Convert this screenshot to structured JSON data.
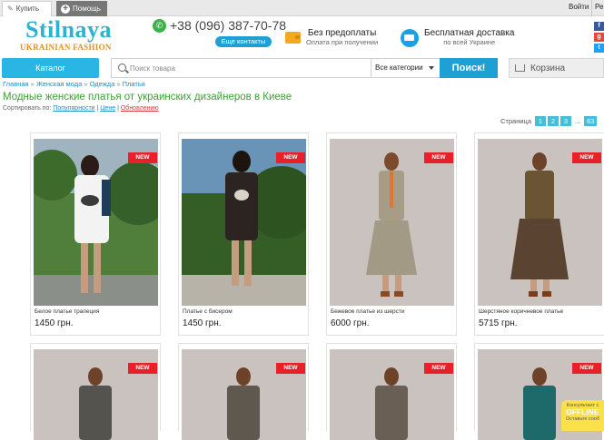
{
  "topbar": {
    "buy_tab": "Купить",
    "help_tab": "Помощь",
    "login": "Войти",
    "register": "Ре"
  },
  "logo": {
    "name": "Stilnaya",
    "tagline": "UKRAINIAN FASHION"
  },
  "header": {
    "phone": "+38 (096) 387-70-78",
    "contacts_button": "Еще контакты",
    "feature1": {
      "title": "Без предоплаты",
      "subtitle": "Оплата при получении"
    },
    "feature2": {
      "title": "Бесплатная доставка",
      "subtitle": "по всей Украине"
    }
  },
  "nav": {
    "catalog_button": "Каталог",
    "search_placeholder": "Поиск товара",
    "category_select": "Все категории",
    "search_button": "Поиск!",
    "cart_label": "Корзина"
  },
  "breadcrumb": [
    "Главная",
    "Женская мода",
    "Одежда",
    "Платья"
  ],
  "page_title": "Модные женские платья от украинских дизайнеров в Киеве",
  "sort": {
    "label": "Сортировать по:",
    "options": [
      "Популярности",
      "Цене",
      "Обновлению"
    ]
  },
  "pagination": {
    "label": "Страница",
    "pages": [
      "1",
      "2",
      "3"
    ],
    "dots": "...",
    "last": "63"
  },
  "products": [
    {
      "name": "Белое платье трапеция",
      "price": "1450 грн.",
      "badge": "NEW"
    },
    {
      "name": "Платье с бисером",
      "price": "1450 грн.",
      "badge": "NEW"
    },
    {
      "name": "Бежевое платье из шерсти",
      "price": "6000 грн.",
      "badge": "NEW"
    },
    {
      "name": "Шерстяное коричневое платье",
      "price": "5715 грн.",
      "badge": "NEW"
    },
    {
      "name": "",
      "price": "",
      "badge": "NEW"
    },
    {
      "name": "",
      "price": "",
      "badge": "NEW"
    },
    {
      "name": "",
      "price": "",
      "badge": "NEW"
    },
    {
      "name": "",
      "price": "",
      "badge": "NEW"
    }
  ],
  "chat_widget": {
    "line1": "Консультант с",
    "line2": "OFFLINE",
    "line3": "Оставьте сооб"
  }
}
